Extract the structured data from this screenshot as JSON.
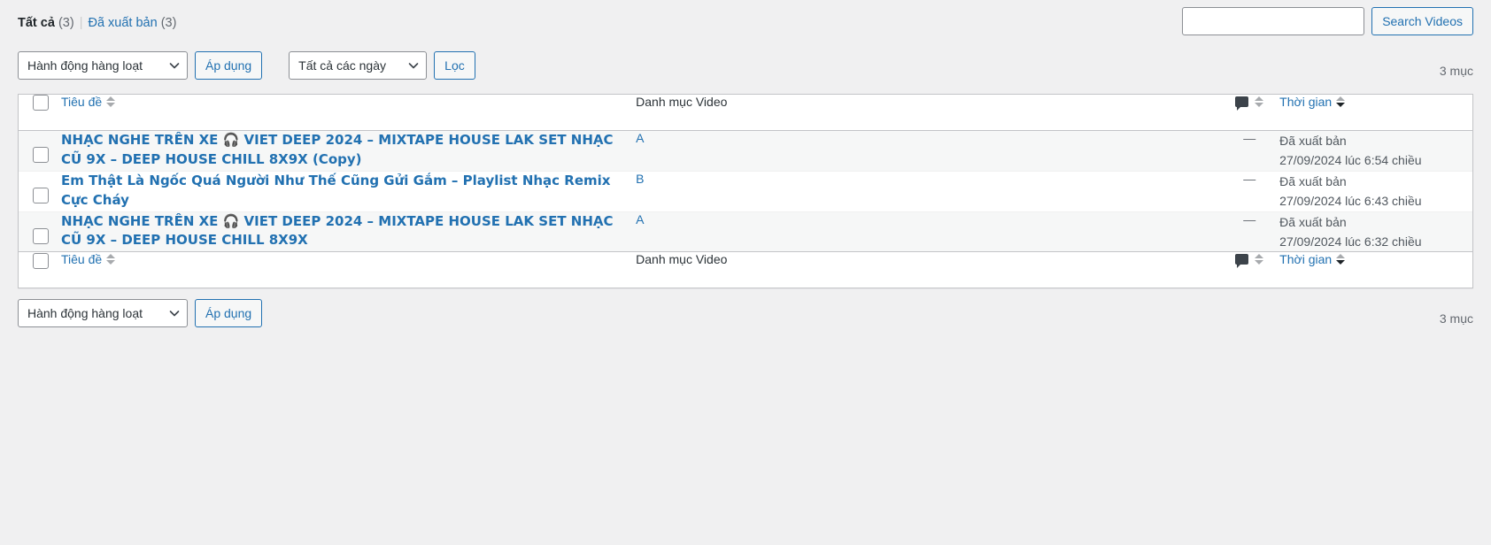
{
  "status_links": {
    "all": {
      "label": "Tất cả",
      "count": "(3)"
    },
    "separator": "|",
    "published": {
      "label": "Đã xuất bản",
      "count": "(3)"
    }
  },
  "search": {
    "value": "",
    "placeholder": "",
    "button_label": "Search Videos"
  },
  "tablenav_top": {
    "bulk_actions_label": "Hành động hàng loạt",
    "apply_label": "Áp dụng",
    "date_filter_label": "Tất cả các ngày",
    "filter_label": "Lọc",
    "displaying_num": "3 mục"
  },
  "tablenav_bottom": {
    "bulk_actions_label": "Hành động hàng loạt",
    "apply_label": "Áp dụng",
    "displaying_num": "3 mục"
  },
  "table": {
    "columns": {
      "title": "Tiêu đề",
      "category": "Danh mục Video",
      "comments": "comment-bubble-icon",
      "date": "Thời gian"
    },
    "sort": {
      "title_state": "none",
      "comments_state": "none",
      "date_state": "desc"
    },
    "rows": [
      {
        "title": "NHẠC NGHE TRÊN XE 🎧 VIET DEEP 2024 – MIXTAPE HOUSE LAK SET NHẠC CŨ 9X – DEEP HOUSE CHILL 8X9X (Copy)",
        "category": "A",
        "comments": "—",
        "date_status": "Đã xuất bản",
        "date_when": "27/09/2024 lúc 6:54 chiều"
      },
      {
        "title": "Em Thật Là Ngốc Quá Người Như Thế Cũng Gửi Gắm – Playlist Nhạc Remix Cực Cháy",
        "category": "B",
        "comments": "—",
        "date_status": "Đã xuất bản",
        "date_when": "27/09/2024 lúc 6:43 chiều"
      },
      {
        "title": "NHẠC NGHE TRÊN XE 🎧 VIET DEEP 2024 – MIXTAPE HOUSE LAK SET NHẠC CŨ 9X – DEEP HOUSE CHILL 8X9X",
        "category": "A",
        "comments": "—",
        "date_status": "Đã xuất bản",
        "date_when": "27/09/2024 lúc 6:32 chiều"
      }
    ]
  },
  "colors": {
    "link": "#2271b1",
    "text": "#3c434a",
    "muted": "#646970",
    "background": "#f0f0f1",
    "row_alt": "#f6f7f7",
    "border": "#c3c4c7"
  }
}
